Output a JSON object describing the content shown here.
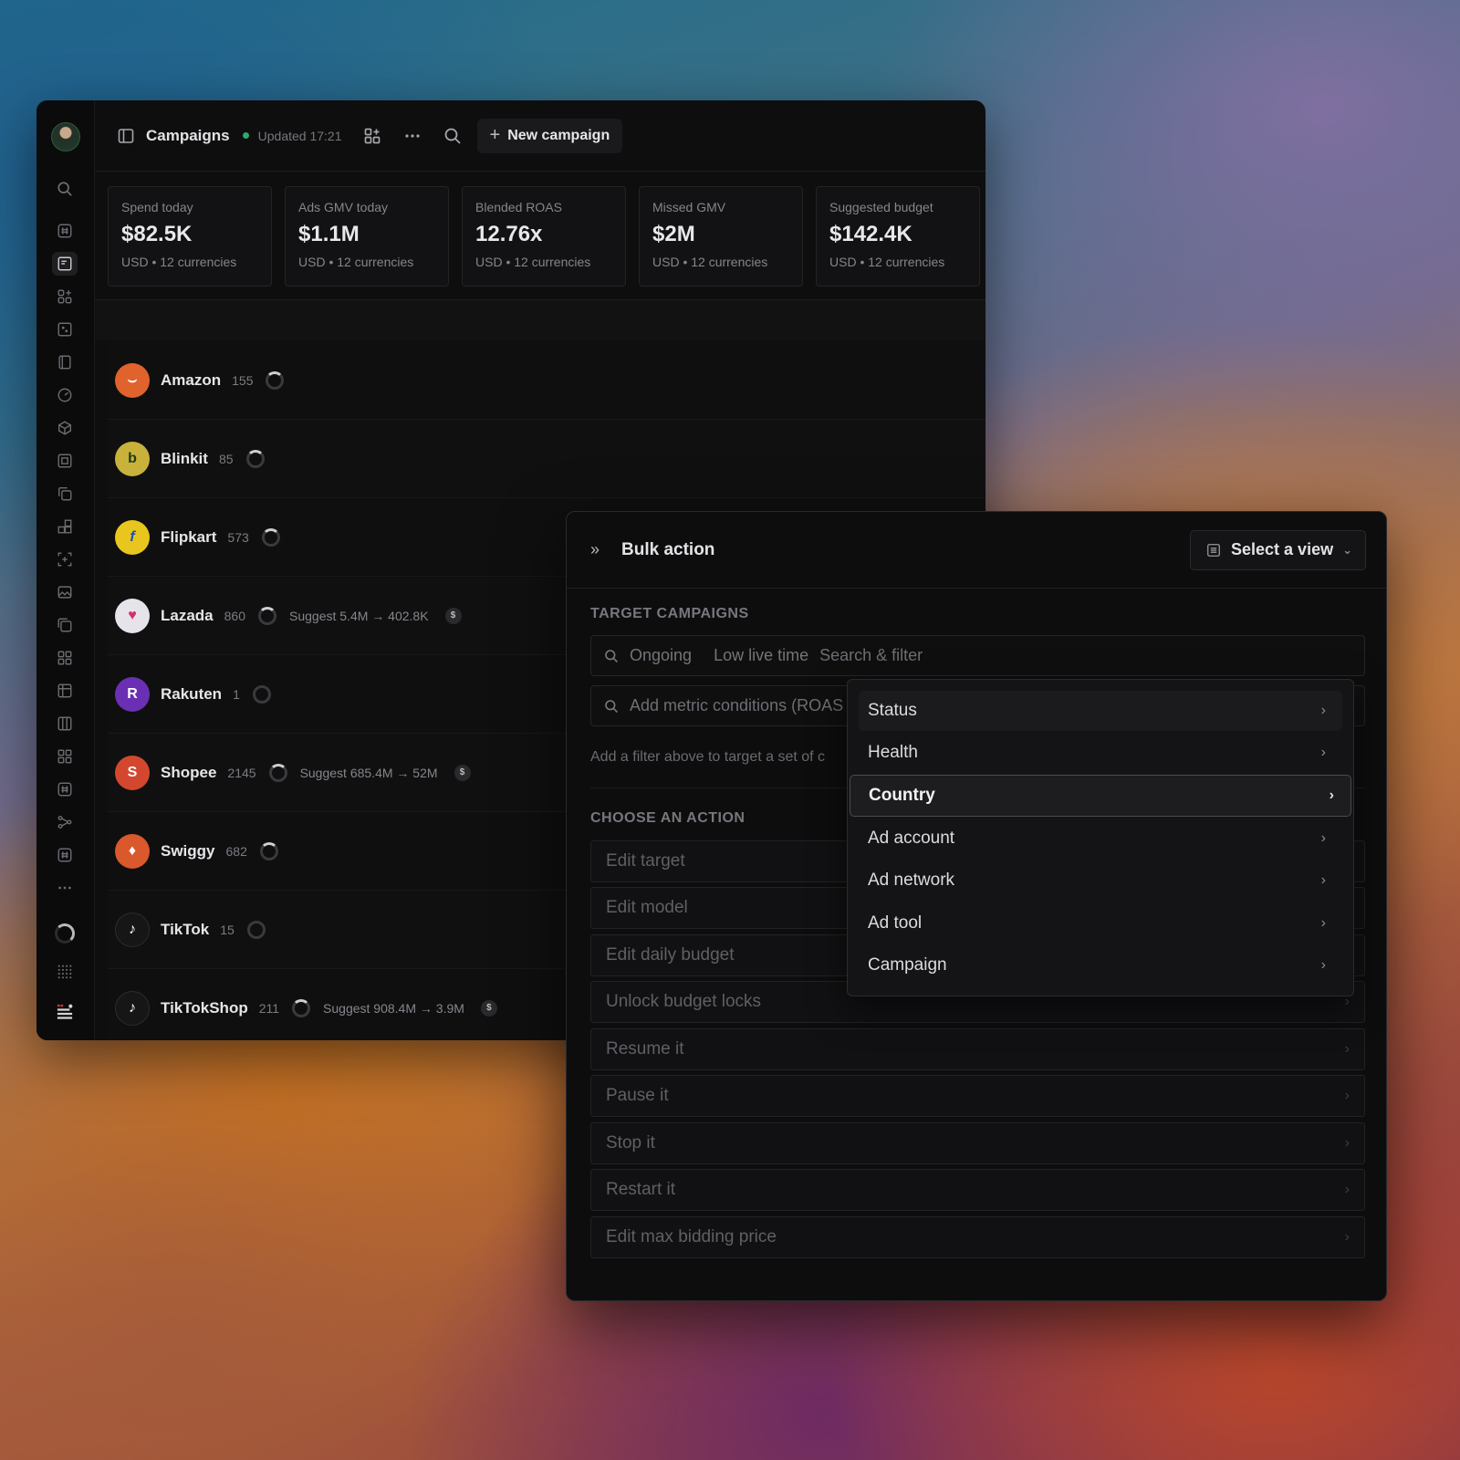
{
  "header": {
    "title": "Campaigns",
    "updated": "Updated 17:21",
    "new_campaign": "New campaign"
  },
  "stats": [
    {
      "label": "Spend today",
      "value": "$82.5K",
      "sub": "USD • 12 currencies"
    },
    {
      "label": "Ads GMV today",
      "value": "$1.1M",
      "sub": "USD • 12 currencies"
    },
    {
      "label": "Blended ROAS",
      "value": "12.76x",
      "sub": "USD • 12 currencies"
    },
    {
      "label": "Missed GMV",
      "value": "$2M",
      "sub": "USD • 12 currencies"
    },
    {
      "label": "Suggested budget",
      "value": "$142.4K",
      "sub": "USD • 12 currencies"
    }
  ],
  "channels": [
    {
      "name": "Amazon",
      "count": "155",
      "suggest": "",
      "color": "#e0622d",
      "logo": "⌣"
    },
    {
      "name": "Blinkit",
      "count": "85",
      "suggest": "",
      "color": "#c9b23b",
      "logo": "b"
    },
    {
      "name": "Flipkart",
      "count": "573",
      "suggest": "",
      "color": "#e9c61e",
      "logo": "f"
    },
    {
      "name": "Lazada",
      "count": "860",
      "suggest": "Suggest 5.4M → 402.8K",
      "color": "#e7e3ea",
      "logo": "♥"
    },
    {
      "name": "Rakuten",
      "count": "1",
      "suggest": "",
      "color": "#6a2fb3",
      "logo": "R"
    },
    {
      "name": "Shopee",
      "count": "2145",
      "suggest": "Suggest 685.4M → 52M",
      "color": "#d4472f",
      "logo": "S"
    },
    {
      "name": "Swiggy",
      "count": "682",
      "suggest": "",
      "color": "#d9582c",
      "logo": "♦"
    },
    {
      "name": "TikTok",
      "count": "15",
      "suggest": "",
      "color": "#161616",
      "logo": "♪"
    },
    {
      "name": "TikTokShop",
      "count": "211",
      "suggest": "Suggest 908.4M → 3.9M",
      "color": "#161616",
      "logo": "♪"
    }
  ],
  "panel": {
    "title": "Bulk action",
    "view_select": "Select a view",
    "target_label": "TARGET CAMPAIGNS",
    "chip1": "Ongoing",
    "chip2": "Low live time",
    "search_placeholder": "Search & filter",
    "metric_placeholder": "Add metric conditions (ROAS",
    "hint": "Add a filter above to target a set of c",
    "action_label": "CHOOSE AN ACTION",
    "actions": [
      "Edit target",
      "Edit model",
      "Edit daily budget",
      "Unlock budget locks",
      "Resume it",
      "Pause it",
      "Stop it",
      "Restart it",
      "Edit max bidding price"
    ]
  },
  "dropdown": {
    "items": [
      "Status",
      "Health",
      "Country",
      "Ad account",
      "Ad network",
      "Ad tool",
      "Campaign"
    ],
    "selected": "Country"
  }
}
